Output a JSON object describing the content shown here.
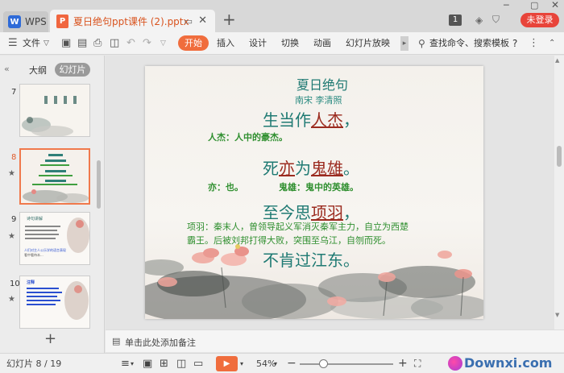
{
  "titlebar": {
    "app_name": "WPS",
    "app_logo": "W",
    "doc_title": "夏日绝句ppt课件 (2).pptx",
    "doc_icon": "P",
    "page_badge": "1",
    "login_label": "未登录"
  },
  "toolbar": {
    "file_label": "文件",
    "tabs": [
      "开始",
      "插入",
      "设计",
      "切换",
      "动画",
      "幻灯片放映"
    ],
    "search_label": "查找命令、搜索模板",
    "help": "?"
  },
  "left_panel": {
    "outline_tab": "大纲",
    "slides_tab": "幻灯片",
    "thumbnails": [
      {
        "num": "7"
      },
      {
        "num": "8"
      },
      {
        "num": "9",
        "heading": "诗句讲解",
        "line1": "人们对主人公乐学的语言表现",
        "line2": "看中看待本..."
      },
      {
        "num": "10",
        "heading": "注释"
      }
    ]
  },
  "slide": {
    "title": "夏日绝句",
    "author": "南宋  李清照",
    "line1": "生当作人杰，",
    "line1_plain": "生当作",
    "line1_key": "人杰",
    "line1_end": "，",
    "note1": "人杰：人中的豪杰。",
    "line2_a": "死",
    "line2_b": "亦",
    "line2_c": "为",
    "line2_d": "鬼雄",
    "line2_e": "。",
    "note2a": "亦：也。",
    "note2b": "鬼雄：鬼中的英雄。",
    "line3_plain": "至今思",
    "line3_key": "项羽",
    "line3_end": "，",
    "note3a": "项羽：秦末人，曾领导起义军消灭秦军主力，自立为西楚",
    "note3b": "霸王。后被刘邦打得大败，突围至乌江，自刎而死。",
    "line4": "不肯过江东。"
  },
  "notes": {
    "placeholder": "单击此处添加备注"
  },
  "status": {
    "slide_counter": "幻灯片 8 / 19",
    "zoom": "54%",
    "watermark": "Downxi.com"
  },
  "colors": {
    "accent": "#f06d3d",
    "slide_teal": "#1f7a73",
    "slide_red": "#9b2b1f",
    "slide_green": "#2f8f2f"
  }
}
